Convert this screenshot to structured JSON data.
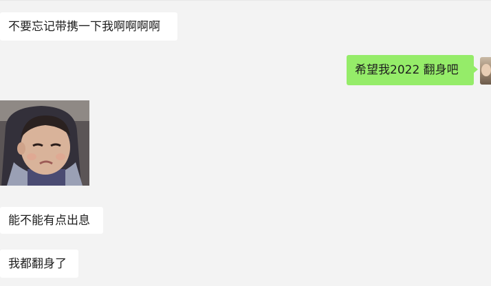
{
  "messages": [
    {
      "side": "left",
      "text": "不要忘记带携一下我啊啊啊啊"
    },
    {
      "side": "right",
      "text": "希望我2022 翻身吧"
    },
    {
      "side": "left",
      "type": "image",
      "image_name": "crying-toddler-in-car-seat-sticker"
    },
    {
      "side": "left",
      "text": "能不能有点出息"
    },
    {
      "side": "left",
      "text": "我都翻身了"
    }
  ],
  "colors": {
    "background": "#f3f3f3",
    "incoming_bubble": "#ffffff",
    "outgoing_bubble": "#95ec69",
    "text": "#1e1e1e"
  },
  "icons": {
    "self_avatar": "user-avatar"
  }
}
